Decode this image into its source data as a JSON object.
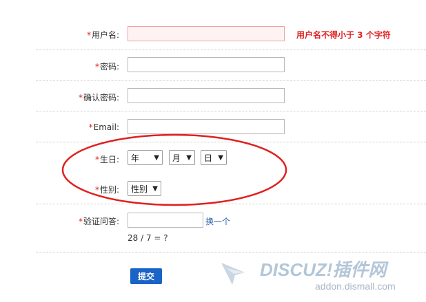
{
  "form": {
    "required_mark": "*",
    "username": {
      "label": "用户名:",
      "value": "",
      "error": "用户名不得小于 3 个字符"
    },
    "password": {
      "label": "密码:",
      "value": ""
    },
    "confirm_password": {
      "label": "确认密码:",
      "value": ""
    },
    "email": {
      "label": "Email:",
      "value": ""
    },
    "birthday": {
      "label": "生日:",
      "year": "年",
      "month": "月",
      "day": "日"
    },
    "gender": {
      "label": "性别:",
      "value": "性别"
    },
    "captcha": {
      "label": "验证问答:",
      "value": "",
      "refresh_link": "换一个",
      "question": "28 / 7 = ?"
    },
    "submit_label": "提交"
  },
  "watermark": {
    "brand": "DISCUZ!插件网",
    "url": "addon.dismall.com"
  },
  "colors": {
    "required": "#e02020",
    "link": "#2a64b0",
    "button": "#1a63c7",
    "annotation": "#e02020"
  }
}
